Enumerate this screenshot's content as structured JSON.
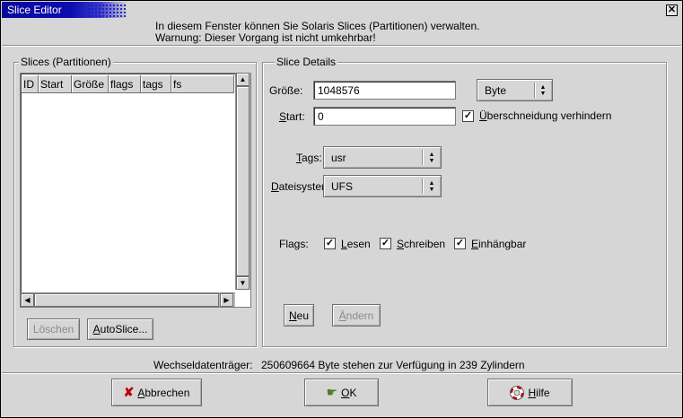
{
  "window": {
    "title": "Slice Editor"
  },
  "info": {
    "line1": "In diesem Fenster können Sie Solaris Slices (Partitionen) verwalten.",
    "line2": "Warnung: Dieser Vorgang ist nicht umkehrbar!"
  },
  "slices": {
    "legend": "Slices (Partitionen)",
    "columns": [
      "ID",
      "Start",
      "Größe",
      "flags",
      "tags",
      "fs"
    ],
    "rows": [],
    "delete_label": "Löschen",
    "autoslice_label_u": "A",
    "autoslice_label_rest": "utoSlice..."
  },
  "details": {
    "legend": "Slice Details",
    "size_label": "Größe:",
    "size_value": "1048576",
    "unit_value": "Byte",
    "start_label_u": "S",
    "start_label_rest": "tart:",
    "start_value": "0",
    "overlap_u": "Ü",
    "overlap_rest": "berschneidung verhindern",
    "overlap_checked": true,
    "tags_label_u": "T",
    "tags_label_rest": "ags:",
    "tags_value": "usr",
    "fs_label_u": "D",
    "fs_label_rest": "ateisystem:",
    "fs_value": "UFS",
    "flags_label": "Flags:",
    "flag_read_u": "L",
    "flag_read_rest": "esen",
    "flag_read_checked": true,
    "flag_write_u": "S",
    "flag_write_rest": "chreiben",
    "flag_write_checked": true,
    "flag_mount_u": "E",
    "flag_mount_rest": "inhängbar",
    "flag_mount_checked": true,
    "new_u": "N",
    "new_rest": "eu",
    "change_u": "Ä",
    "change_rest": "ndern"
  },
  "status": {
    "label": "Wechseldatenträger:",
    "text": "250609664 Byte stehen zur Verfügung in  239 Zylindern"
  },
  "footer": {
    "cancel_u": "A",
    "cancel_rest": "bbrechen",
    "ok_u": "O",
    "ok_rest": "K",
    "help_u": "H",
    "help_rest": "ilfe"
  },
  "icons": [
    "close-icon",
    "cancel-x-icon",
    "ok-hand-icon",
    "lifebuoy-icon",
    "checkmark-icon",
    "spin-arrows-icon",
    "scroll-arrow-icon"
  ]
}
